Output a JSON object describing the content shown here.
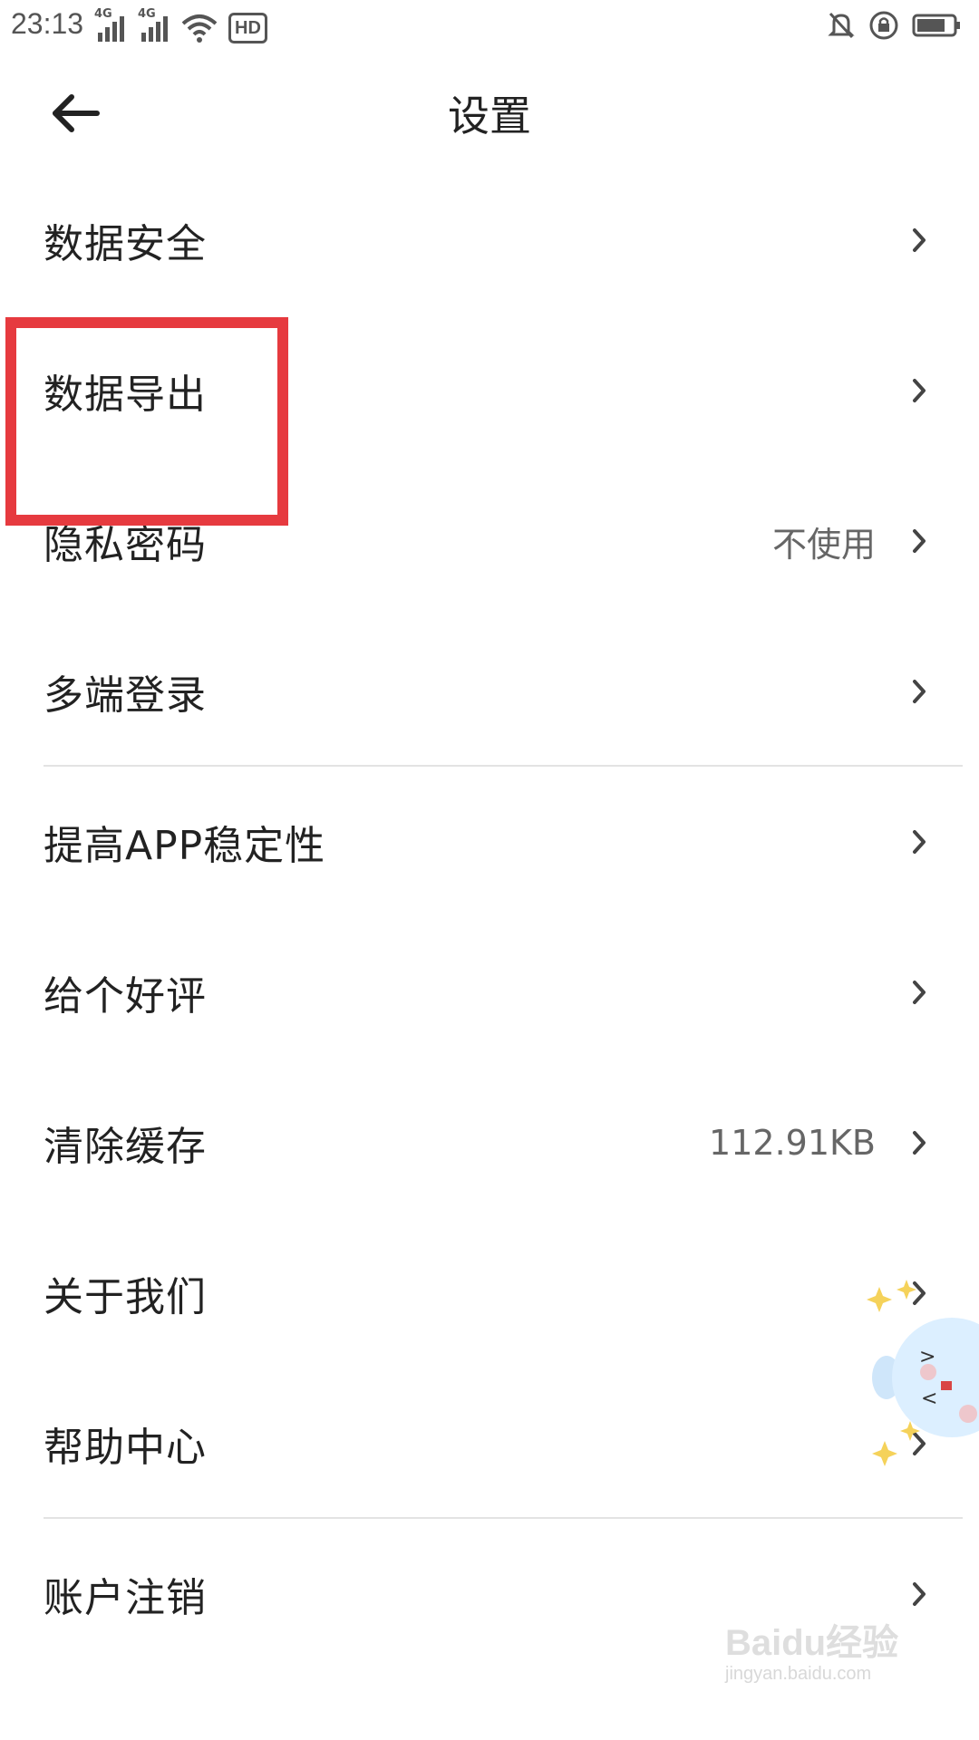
{
  "status_bar": {
    "time": "23:13",
    "network_1": "4G",
    "network_2": "4G",
    "hd_label": "HD",
    "icons": [
      "signal-icon",
      "signal-icon",
      "wifi-icon",
      "hd-icon",
      "mute-bell-icon",
      "rotation-lock-icon",
      "battery-icon"
    ]
  },
  "header": {
    "title": "设置",
    "back_icon": "arrow-left-icon"
  },
  "settings_items": [
    {
      "label": "数据安全",
      "value": ""
    },
    {
      "label": "数据导出",
      "value": ""
    },
    {
      "label": "隐私密码",
      "value": "不使用"
    },
    {
      "label": "多端登录",
      "value": ""
    },
    {
      "label": "提高APP稳定性",
      "value": ""
    },
    {
      "label": "给个好评",
      "value": ""
    },
    {
      "label": "清除缓存",
      "value": "112.91KB"
    },
    {
      "label": "关于我们",
      "value": ""
    },
    {
      "label": "帮助中心",
      "value": ""
    },
    {
      "label": "账户注销",
      "value": ""
    }
  ],
  "watermark": {
    "logo": "Baidu经验",
    "url": "jingyan.baidu.com"
  },
  "colors": {
    "highlight": "#e63a3f",
    "text_primary": "#222222",
    "text_secondary": "#666666",
    "divider": "#e3e3e3"
  }
}
